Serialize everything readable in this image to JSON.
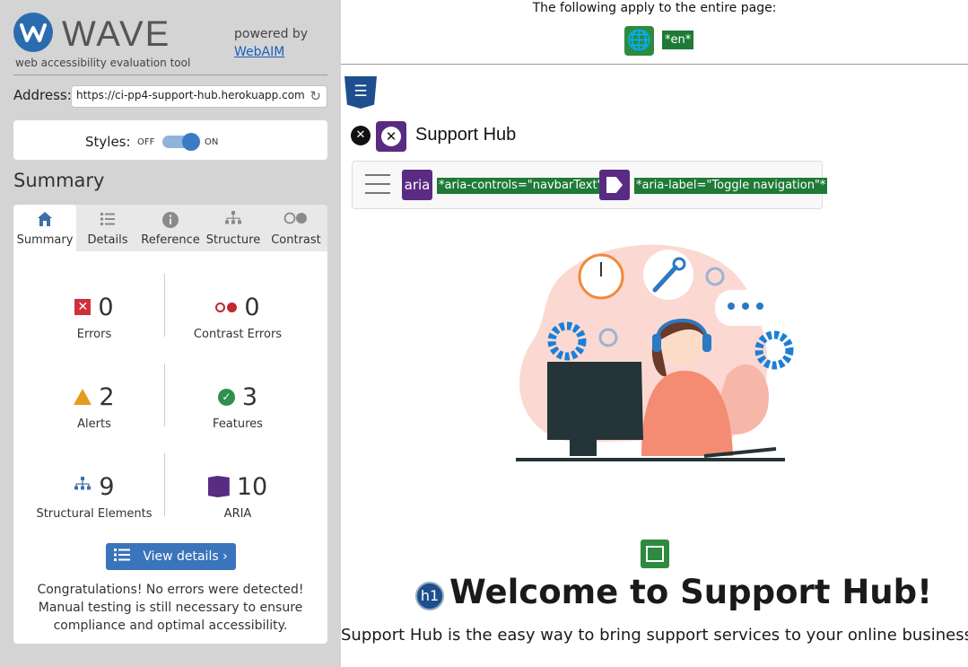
{
  "wave": {
    "logo_text": "WAVE",
    "tagline": "web accessibility evaluation tool",
    "powered_by": "powered by",
    "webaim_link": "WebAIM"
  },
  "address": {
    "label": "Address:",
    "value": "https://ci-pp4-support-hub.herokuapp.com"
  },
  "styles": {
    "label": "Styles:",
    "off": "OFF",
    "on": "ON",
    "state": "on"
  },
  "summary_heading": "Summary",
  "tabs": [
    {
      "label": "Summary",
      "icon": "home-icon",
      "active": true
    },
    {
      "label": "Details",
      "icon": "list-icon"
    },
    {
      "label": "Reference",
      "icon": "info-icon"
    },
    {
      "label": "Structure",
      "icon": "sitemap-icon"
    },
    {
      "label": "Contrast",
      "icon": "contrast-icon"
    }
  ],
  "stats": {
    "errors": {
      "value": "0",
      "label": "Errors"
    },
    "contrast_errors": {
      "value": "0",
      "label": "Contrast Errors"
    },
    "alerts": {
      "value": "2",
      "label": "Alerts"
    },
    "features": {
      "value": "3",
      "label": "Features"
    },
    "structural": {
      "value": "9",
      "label": "Structural Elements"
    },
    "aria": {
      "value": "10",
      "label": "ARIA"
    }
  },
  "view_details_label": "View details ›",
  "congrats": "Congratulations! No errors were detected! Manual testing is still necessary to ensure compliance and optimal accessibility.",
  "preview": {
    "apply_text": "The following apply to the entire page:",
    "lang_tag": "*en*",
    "brand": "Support Hub",
    "aria_label_badge": "aria",
    "aria_controls": "*aria-controls=\"navbarText\"*",
    "aria_label": "*aria-label=\"Toggle navigation\"*",
    "h1_badge": "h1",
    "headline": "Welcome to Support Hub!",
    "tagline": "Support Hub is the easy way to bring support services to your online business!"
  },
  "colors": {
    "sidebar_bg": "#d4d4d4",
    "accent_blue": "#3a74bb",
    "feature_green": "#2e8a3f",
    "aria_purple": "#5a2b82",
    "error_red": "#d0303a"
  }
}
